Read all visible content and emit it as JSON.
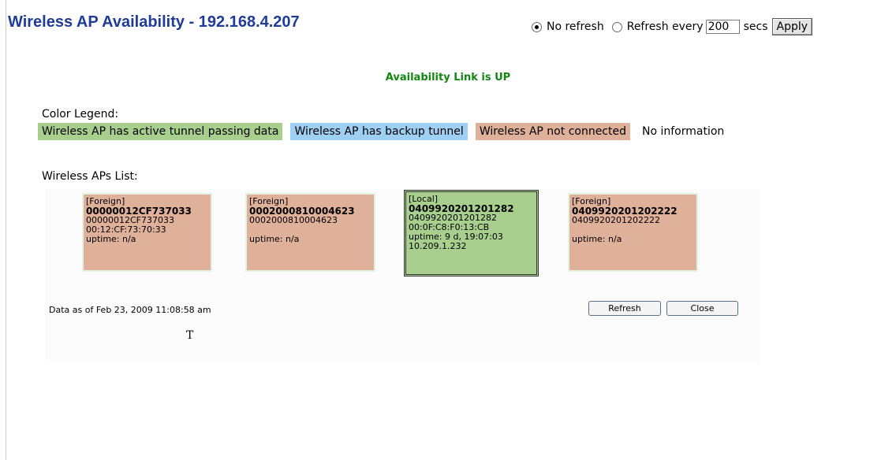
{
  "header": {
    "title": "Wireless AP Availability - 192.168.4.207",
    "no_refresh_label": "No refresh",
    "refresh_every_label": "Refresh every",
    "secs_value": "200",
    "secs_label": "secs",
    "apply_label": "Apply",
    "selected_option": "No refresh"
  },
  "status": "Availability Link is UP",
  "legend": {
    "title": "Color Legend:",
    "items": [
      {
        "label": "Wireless AP has active tunnel passing data",
        "color": "#a8cf8e"
      },
      {
        "label": "Wireless AP has backup tunnel",
        "color": "#9fcff2"
      },
      {
        "label": "Wireless AP not connected",
        "color": "#dfb09a"
      },
      {
        "label": "No information",
        "color": "#ffffff"
      }
    ]
  },
  "ap_list": {
    "title": "Wireless APs List:",
    "aps": [
      {
        "type": "[Foreign]",
        "id": "00000012CF737033",
        "serial": "00000012CF737033",
        "mac": "00:12:CF:73:70:33",
        "uptime": "uptime: n/a",
        "ip": ""
      },
      {
        "type": "[Foreign]",
        "id": "0002000810004623",
        "serial": "0002000810004623",
        "mac": "",
        "uptime": "uptime: n/a",
        "ip": ""
      },
      {
        "type": "[Local]",
        "id": "0409920201201282",
        "serial": "0409920201201282",
        "mac": "00:0F:C8:F0:13:CB",
        "uptime": "uptime: 9 d, 19:07:03",
        "ip": "10.209.1.232"
      },
      {
        "type": "[Foreign]",
        "id": "0409920201202222",
        "serial": "0409920201202222",
        "mac": "",
        "uptime": "uptime: n/a",
        "ip": ""
      }
    ]
  },
  "footer": {
    "data_as_of": "Data as of Feb 23, 2009 11:08:58 am",
    "refresh_label": "Refresh",
    "close_label": "Close"
  }
}
